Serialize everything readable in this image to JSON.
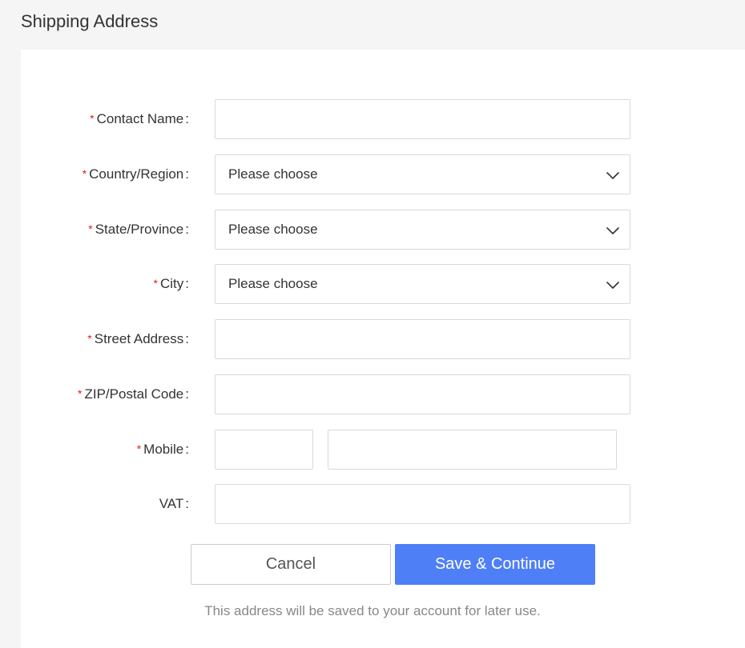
{
  "page": {
    "title": "Shipping Address"
  },
  "form": {
    "contact_name": {
      "label": "Contact Name",
      "required": true,
      "value": ""
    },
    "country_region": {
      "label": "Country/Region",
      "required": true,
      "value": "Please choose",
      "icon": "chevron-down-icon"
    },
    "state_province": {
      "label": "State/Province",
      "required": true,
      "value": "Please choose",
      "icon": "chevron-down-icon"
    },
    "city": {
      "label": "City",
      "required": true,
      "value": "Please choose",
      "icon": "chevron-down-icon"
    },
    "street_address": {
      "label": "Street Address",
      "required": true,
      "value": ""
    },
    "zip_postal_code": {
      "label": "ZIP/Postal Code",
      "required": true,
      "value": ""
    },
    "mobile": {
      "label": "Mobile",
      "required": true,
      "code_value": "",
      "number_value": ""
    },
    "vat": {
      "label": "VAT",
      "required": false,
      "value": ""
    },
    "required_marker": "*",
    "label_suffix": ":"
  },
  "actions": {
    "cancel_label": "Cancel",
    "save_label": "Save & Continue"
  },
  "note": "This address will be saved to your account for later use.",
  "colors": {
    "accent": "#4f7ff7",
    "required_marker": "#e02020",
    "page_background": "#f5f5f5",
    "card_background": "#ffffff",
    "border": "#d9d9d9",
    "note_text": "#888888"
  }
}
